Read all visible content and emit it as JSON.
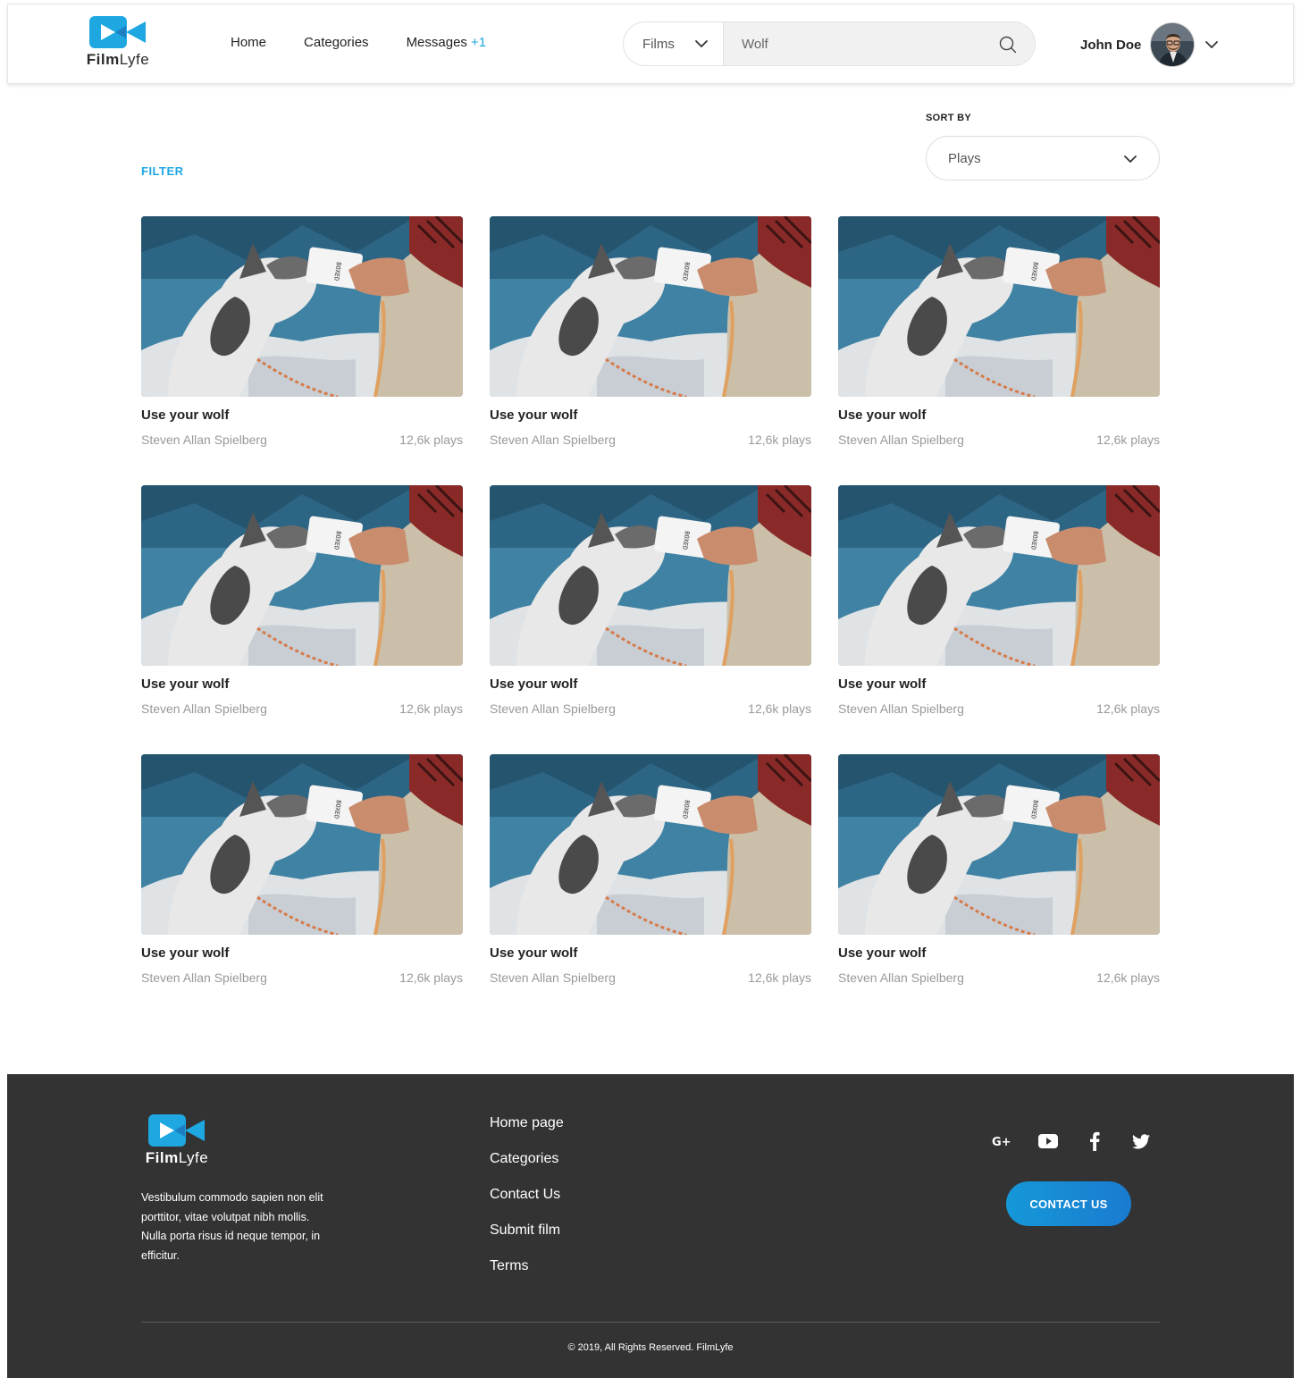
{
  "brand": {
    "name_bold": "Film",
    "name_light": "Lyfe",
    "accent": "#1ea7e1"
  },
  "nav": {
    "items": [
      "Home",
      "Categories",
      "Messages"
    ],
    "messages_badge": "+1"
  },
  "search": {
    "type": "Films",
    "value": "Wolf",
    "icon": "search-icon"
  },
  "user": {
    "name": "John Doe",
    "menu_icon": "chevron-down-icon"
  },
  "filter": {
    "label": "FILTER"
  },
  "sort": {
    "label": "SORT BY",
    "selected": "Plays"
  },
  "films": [
    {
      "title": "Use your wolf",
      "author": "Steven Allan Spielberg",
      "plays": "12,6k plays"
    },
    {
      "title": "Use your wolf",
      "author": "Steven Allan Spielberg",
      "plays": "12,6k plays"
    },
    {
      "title": "Use your wolf",
      "author": "Steven Allan Spielberg",
      "plays": "12,6k plays"
    },
    {
      "title": "Use your wolf",
      "author": "Steven Allan Spielberg",
      "plays": "12,6k plays"
    },
    {
      "title": "Use your wolf",
      "author": "Steven Allan Spielberg",
      "plays": "12,6k plays"
    },
    {
      "title": "Use your wolf",
      "author": "Steven Allan Spielberg",
      "plays": "12,6k plays"
    },
    {
      "title": "Use your wolf",
      "author": "Steven Allan Spielberg",
      "plays": "12,6k plays"
    },
    {
      "title": "Use your wolf",
      "author": "Steven Allan Spielberg",
      "plays": "12,6k plays"
    },
    {
      "title": "Use your wolf",
      "author": "Steven Allan Spielberg",
      "plays": "12,6k plays"
    }
  ],
  "footer": {
    "description": "Vestibulum commodo sapien non elit porttitor, vitae volutpat nibh mollis. Nulla porta risus id neque tempor, in efficitur.",
    "links": [
      "Home page",
      "Categories",
      "Contact Us",
      "Submit film",
      "Terms"
    ],
    "social": [
      "google-plus-icon",
      "youtube-icon",
      "facebook-icon",
      "twitter-icon"
    ],
    "contact_button": "CONTACT US",
    "copyright": "© 2019, All Rights Reserved. FilmLyfe",
    "background": "#333333"
  }
}
